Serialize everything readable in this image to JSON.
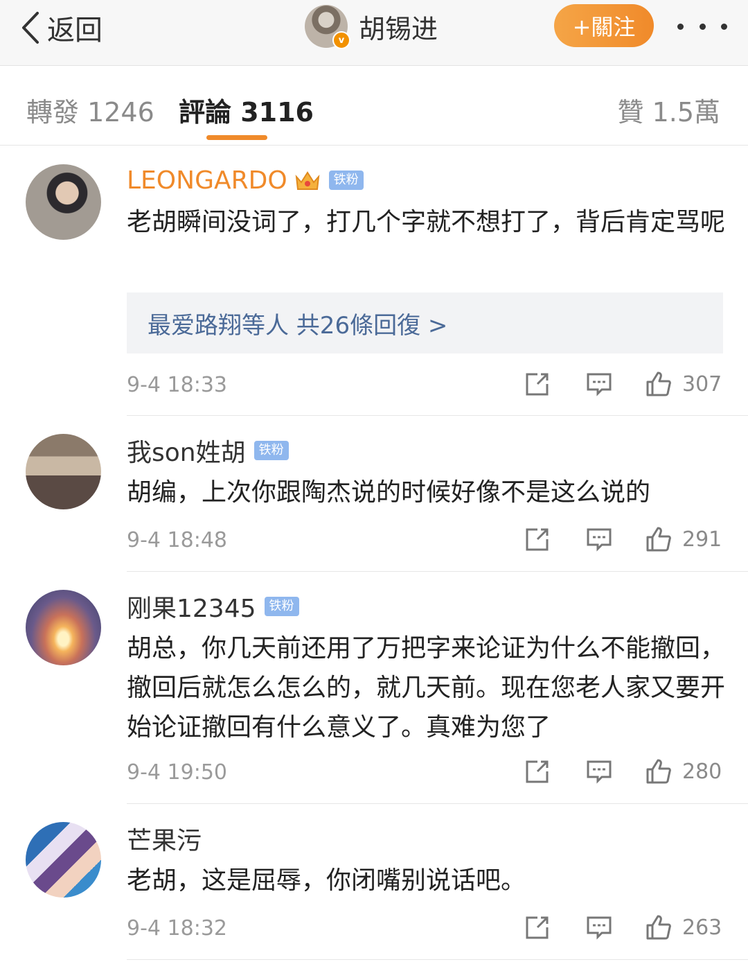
{
  "header": {
    "back_label": "返回",
    "title": "胡锡进",
    "verified_mark": "v",
    "follow_label": "+關注"
  },
  "tabs": {
    "repost": "轉發 1246",
    "comment": "評論 3116",
    "like": "贊 1.5萬"
  },
  "comments": [
    {
      "username": "LEONGARDO",
      "badge": "铁粉",
      "text": "老胡瞬间没词了，打几个字就不想打了，背后肯定骂呢",
      "replies": "最爱路翔等人 共26條回復 >",
      "time": "9-4 18:33",
      "likes": "307"
    },
    {
      "username": "我son姓胡",
      "badge": "铁粉",
      "text": "胡编，上次你跟陶杰说的时候好像不是这么说的",
      "time": "9-4 18:48",
      "likes": "291"
    },
    {
      "username": "刚果12345",
      "badge": "铁粉",
      "text": "胡总，你几天前还用了万把字来论证为什么不能撤回，撤回后就怎么怎么的，就几天前。现在您老人家又要开始论证撤回有什么意义了。真难为您了",
      "time": "9-4 19:50",
      "likes": "280"
    },
    {
      "username": "芒果污",
      "text": "老胡，这是屈辱，你闭嘴别说话吧。",
      "time": "9-4 18:32",
      "likes": "263"
    }
  ],
  "colors": {
    "accent": "#f08a2a",
    "link": "#4b6a98",
    "badge": "#8fb7ee"
  }
}
